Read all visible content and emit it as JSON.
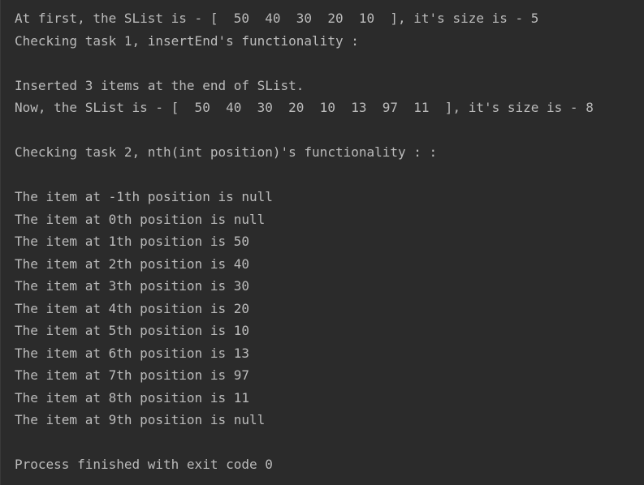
{
  "console": {
    "lines": [
      "At first, the SList is - [  50  40  30  20  10  ], it's size is - 5",
      "Checking task 1, insertEnd's functionality :",
      "",
      "Inserted 3 items at the end of SList.",
      "Now, the SList is - [  50  40  30  20  10  13  97  11  ], it's size is - 8",
      "",
      "Checking task 2, nth(int position)'s functionality : :",
      "",
      "The item at -1th position is null",
      "The item at 0th position is null",
      "The item at 1th position is 50",
      "The item at 2th position is 40",
      "The item at 3th position is 30",
      "The item at 4th position is 20",
      "The item at 5th position is 10",
      "The item at 6th position is 13",
      "The item at 7th position is 97",
      "The item at 8th position is 11",
      "The item at 9th position is null",
      "",
      "Process finished with exit code 0"
    ]
  }
}
